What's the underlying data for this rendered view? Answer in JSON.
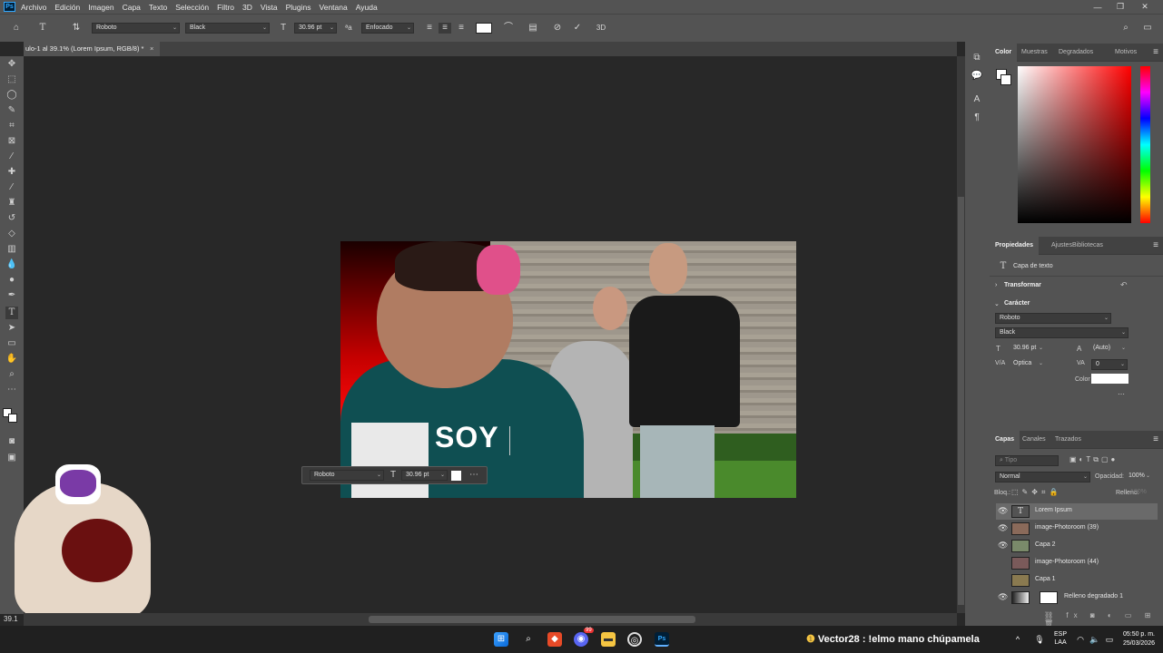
{
  "menu": {
    "app_icon": "Ps",
    "items": [
      "Archivo",
      "Edición",
      "Imagen",
      "Capa",
      "Texto",
      "Selección",
      "Filtro",
      "3D",
      "Vista",
      "Plugins",
      "Ventana",
      "Ayuda"
    ]
  },
  "options": {
    "font_family": "Roboto",
    "font_style": "Black",
    "font_size": "30.96 pt",
    "antialias": "Enfocado",
    "three_d": "3D"
  },
  "document": {
    "tab_title": "ulo-1 al 39.1% (Lorem Ipsum, RGB/8) *",
    "zoom": "39.1"
  },
  "canvas": {
    "text": "SOY",
    "mini_font": "Roboto",
    "mini_size": "30.96 pt"
  },
  "color_panel": {
    "tabs": [
      "Color",
      "Muestras",
      "Degradados",
      "Motivos"
    ],
    "colors": {
      "accent": "#ff0000"
    }
  },
  "properties": {
    "tabs": [
      "Propiedades",
      "Ajustes",
      "Bibliotecas"
    ],
    "layer_type": "Capa de texto",
    "transform": "Transformar",
    "character": "Carácter",
    "font": "Roboto",
    "style": "Black",
    "size": "30.96 pt",
    "leading": "(Auto)",
    "kerning": "Óptica",
    "tracking": "0",
    "color_label": "Color"
  },
  "layers": {
    "tabs": [
      "Capas",
      "Canales",
      "Trazados"
    ],
    "search_placeholder": "Tipo",
    "blend": "Normal",
    "opacity_label": "Opacidad:",
    "opacity": "100%",
    "lock_label": "Bloq.:",
    "fill_label": "Relleno:",
    "fill": "100%",
    "items": [
      {
        "name": "Lorem Ipsum",
        "visible": true
      },
      {
        "name": "image-Photoroom (39)",
        "visible": true
      },
      {
        "name": "Capa 2",
        "visible": true
      },
      {
        "name": "image-Photoroom (44)",
        "visible": false
      },
      {
        "name": "Capa 1",
        "visible": false
      },
      {
        "name": "Relleno degradado 1",
        "visible": true
      }
    ]
  },
  "taskbar": {
    "chat": "Vector28 : !elmo mano chúpamela",
    "lang": "ESP",
    "lang_sub": "LAA",
    "time": "05:50 p. m.",
    "date": "25/03/2026",
    "badge": "99"
  }
}
